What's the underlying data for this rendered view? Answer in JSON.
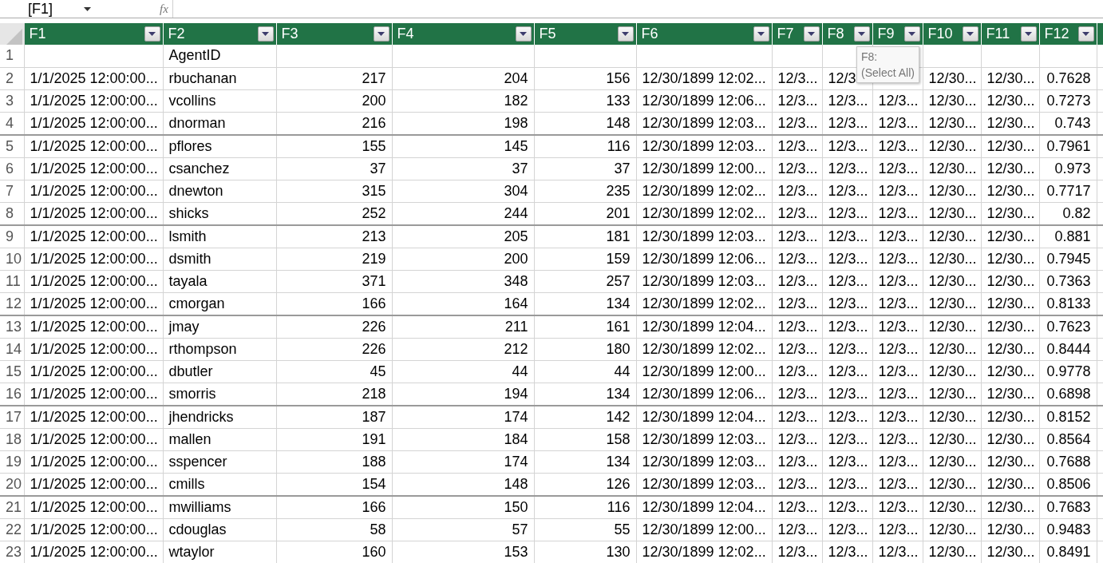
{
  "formula_bar": {
    "name_box": "[F1]",
    "fx": "fx"
  },
  "columns": [
    {
      "label": "F1",
      "kind": "text"
    },
    {
      "label": "F2",
      "kind": "text"
    },
    {
      "label": "F3",
      "kind": "number"
    },
    {
      "label": "F4",
      "kind": "number"
    },
    {
      "label": "F5",
      "kind": "number"
    },
    {
      "label": "F6",
      "kind": "text"
    },
    {
      "label": "F7",
      "kind": "text"
    },
    {
      "label": "F8",
      "kind": "text"
    },
    {
      "label": "F9",
      "kind": "text"
    },
    {
      "label": "F10",
      "kind": "text"
    },
    {
      "label": "F11",
      "kind": "text"
    },
    {
      "label": "F12",
      "kind": "number"
    }
  ],
  "rows": [
    {
      "number": "1",
      "cells": [
        null,
        "AgentID",
        null,
        null,
        null,
        null,
        null,
        null,
        null,
        null,
        null,
        null
      ]
    },
    {
      "number": "2",
      "cells": [
        "1/1/2025 12:00:00...",
        "rbuchanan",
        "217",
        "204",
        "156",
        "12/30/1899 12:02...",
        "12/3...",
        "12/3",
        null,
        "12/30...",
        "12/30...",
        "0.7628"
      ]
    },
    {
      "number": "3",
      "cells": [
        "1/1/2025 12:00:00...",
        "vcollins",
        "200",
        "182",
        "133",
        "12/30/1899 12:06...",
        "12/3...",
        "12/3...",
        "12/3...",
        "12/30...",
        "12/30...",
        "0.7273"
      ]
    },
    {
      "number": "4",
      "cells": [
        "1/1/2025 12:00:00...",
        "dnorman",
        "216",
        "198",
        "148",
        "12/30/1899 12:03...",
        "12/3...",
        "12/3...",
        "12/3...",
        "12/30...",
        "12/30...",
        "0.743"
      ]
    },
    {
      "number": "5",
      "cells": [
        "1/1/2025 12:00:00...",
        "pflores",
        "155",
        "145",
        "116",
        "12/30/1899 12:03...",
        "12/3...",
        "12/3...",
        "12/3...",
        "12/30...",
        "12/30...",
        "0.7961"
      ]
    },
    {
      "number": "6",
      "cells": [
        "1/1/2025 12:00:00...",
        "csanchez",
        "37",
        "37",
        "37",
        "12/30/1899 12:00...",
        "12/3...",
        "12/3...",
        "12/3...",
        "12/30...",
        "12/30...",
        "0.973"
      ]
    },
    {
      "number": "7",
      "cells": [
        "1/1/2025 12:00:00...",
        "dnewton",
        "315",
        "304",
        "235",
        "12/30/1899 12:02...",
        "12/3...",
        "12/3...",
        "12/3...",
        "12/30...",
        "12/30...",
        "0.7717"
      ]
    },
    {
      "number": "8",
      "cells": [
        "1/1/2025 12:00:00...",
        "shicks",
        "252",
        "244",
        "201",
        "12/30/1899 12:02...",
        "12/3...",
        "12/3...",
        "12/3...",
        "12/30...",
        "12/30...",
        "0.82"
      ]
    },
    {
      "number": "9",
      "cells": [
        "1/1/2025 12:00:00...",
        "lsmith",
        "213",
        "205",
        "181",
        "12/30/1899 12:03...",
        "12/3...",
        "12/3...",
        "12/3...",
        "12/30...",
        "12/30...",
        "0.881"
      ]
    },
    {
      "number": "10",
      "cells": [
        "1/1/2025 12:00:00...",
        "dsmith",
        "219",
        "200",
        "159",
        "12/30/1899 12:06...",
        "12/3...",
        "12/3...",
        "12/3...",
        "12/30...",
        "12/30...",
        "0.7945"
      ]
    },
    {
      "number": "11",
      "cells": [
        "1/1/2025 12:00:00...",
        "tayala",
        "371",
        "348",
        "257",
        "12/30/1899 12:03...",
        "12/3...",
        "12/3...",
        "12/3...",
        "12/30...",
        "12/30...",
        "0.7363"
      ]
    },
    {
      "number": "12",
      "cells": [
        "1/1/2025 12:00:00...",
        "cmorgan",
        "166",
        "164",
        "134",
        "12/30/1899 12:02...",
        "12/3...",
        "12/3...",
        "12/3...",
        "12/30...",
        "12/30...",
        "0.8133"
      ]
    },
    {
      "number": "13",
      "cells": [
        "1/1/2025 12:00:00...",
        "jmay",
        "226",
        "211",
        "161",
        "12/30/1899 12:04...",
        "12/3...",
        "12/3...",
        "12/3...",
        "12/30...",
        "12/30...",
        "0.7623"
      ]
    },
    {
      "number": "14",
      "cells": [
        "1/1/2025 12:00:00...",
        "rthompson",
        "226",
        "212",
        "180",
        "12/30/1899 12:02...",
        "12/3...",
        "12/3...",
        "12/3...",
        "12/30...",
        "12/30...",
        "0.8444"
      ]
    },
    {
      "number": "15",
      "cells": [
        "1/1/2025 12:00:00...",
        "dbutler",
        "45",
        "44",
        "44",
        "12/30/1899 12:00...",
        "12/3...",
        "12/3...",
        "12/3...",
        "12/30...",
        "12/30...",
        "0.9778"
      ]
    },
    {
      "number": "16",
      "cells": [
        "1/1/2025 12:00:00...",
        "smorris",
        "218",
        "194",
        "134",
        "12/30/1899 12:06...",
        "12/3...",
        "12/3...",
        "12/3...",
        "12/30...",
        "12/30...",
        "0.6898"
      ]
    },
    {
      "number": "17",
      "cells": [
        "1/1/2025 12:00:00...",
        "jhendricks",
        "187",
        "174",
        "142",
        "12/30/1899 12:04...",
        "12/3...",
        "12/3...",
        "12/3...",
        "12/30...",
        "12/30...",
        "0.8152"
      ]
    },
    {
      "number": "18",
      "cells": [
        "1/1/2025 12:00:00...",
        "mallen",
        "191",
        "184",
        "158",
        "12/30/1899 12:03...",
        "12/3...",
        "12/3...",
        "12/3...",
        "12/30...",
        "12/30...",
        "0.8564"
      ]
    },
    {
      "number": "19",
      "cells": [
        "1/1/2025 12:00:00...",
        "sspencer",
        "188",
        "174",
        "134",
        "12/30/1899 12:03...",
        "12/3...",
        "12/3...",
        "12/3...",
        "12/30...",
        "12/30...",
        "0.7688"
      ]
    },
    {
      "number": "20",
      "cells": [
        "1/1/2025 12:00:00...",
        "cmills",
        "154",
        "148",
        "126",
        "12/30/1899 12:03...",
        "12/3...",
        "12/3...",
        "12/3...",
        "12/30...",
        "12/30...",
        "0.8506"
      ]
    },
    {
      "number": "21",
      "cells": [
        "1/1/2025 12:00:00...",
        "mwilliams",
        "166",
        "150",
        "116",
        "12/30/1899 12:04...",
        "12/3...",
        "12/3...",
        "12/3...",
        "12/30...",
        "12/30...",
        "0.7683"
      ]
    },
    {
      "number": "22",
      "cells": [
        "1/1/2025 12:00:00...",
        "cdouglas",
        "58",
        "57",
        "55",
        "12/30/1899 12:00...",
        "12/3...",
        "12/3...",
        "12/3...",
        "12/30...",
        "12/30...",
        "0.9483"
      ]
    },
    {
      "number": "23",
      "cells": [
        "1/1/2025 12:00:00...",
        "wtaylor",
        "160",
        "153",
        "130",
        "12/30/1899 12:02...",
        "12/3...",
        "12/3...",
        "12/3...",
        "12/30...",
        "12/30...",
        "0.8491"
      ]
    }
  ],
  "tooltip": {
    "title": "F8:",
    "item": "(Select All)"
  }
}
